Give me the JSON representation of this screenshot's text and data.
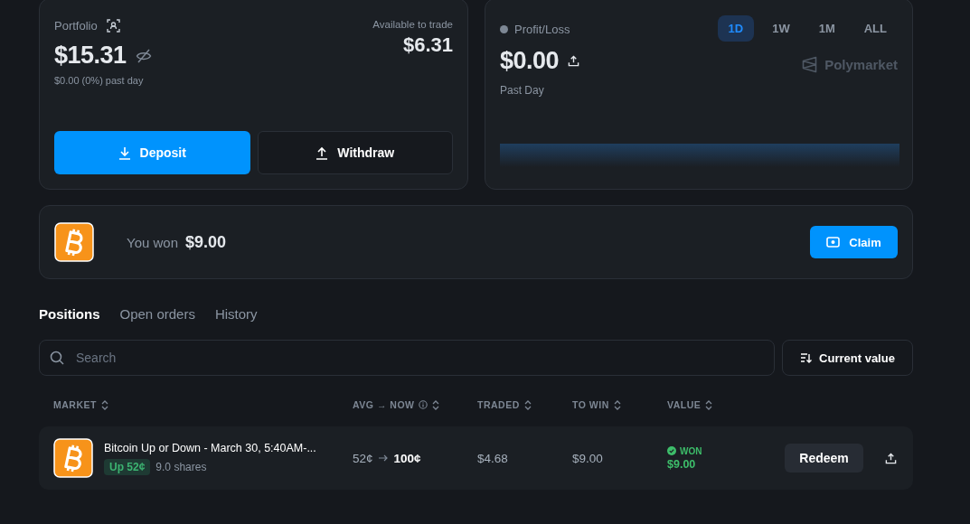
{
  "portfolio": {
    "label": "Portfolio",
    "value": "$15.31",
    "change": "$0.00 (0%) past day",
    "available_label": "Available to trade",
    "available_value": "$6.31",
    "buttons": [
      {
        "label": "Deposit",
        "kind": "primary"
      },
      {
        "label": "Withdraw",
        "kind": "secondary"
      }
    ]
  },
  "pnl": {
    "label": "Profit/Loss",
    "value": "$0.00",
    "period": "Past Day",
    "brand": "Polymarket",
    "ranges": [
      {
        "label": "1D",
        "selected": true
      },
      {
        "label": "1W",
        "selected": false
      },
      {
        "label": "1M",
        "selected": false
      },
      {
        "label": "ALL",
        "selected": false
      }
    ]
  },
  "win_banner": {
    "text": "You won",
    "amount": "$9.00",
    "button": "Claim"
  },
  "tabs": [
    {
      "label": "Positions",
      "selected": true
    },
    {
      "label": "Open orders",
      "selected": false
    },
    {
      "label": "History",
      "selected": false
    }
  ],
  "search": {
    "placeholder": "Search"
  },
  "sort_button": "Current value",
  "table": {
    "columns": [
      {
        "label": "MARKET",
        "info": false
      },
      {
        "label": "AVG → NOW",
        "info": true
      },
      {
        "label": "TRADED",
        "info": false
      },
      {
        "label": "TO WIN",
        "info": false
      },
      {
        "label": "VALUE",
        "info": false
      }
    ],
    "rows": [
      {
        "title": "Bitcoin Up or Down - March 30, 5:40AM-...",
        "outcome": "Up 52¢",
        "shares": "9.0 shares",
        "avg": "52¢",
        "now": "100¢",
        "traded": "$4.68",
        "to_win": "$9.00",
        "status": "WON",
        "won": true,
        "value": "$9.00",
        "action": "Redeem"
      }
    ]
  }
}
